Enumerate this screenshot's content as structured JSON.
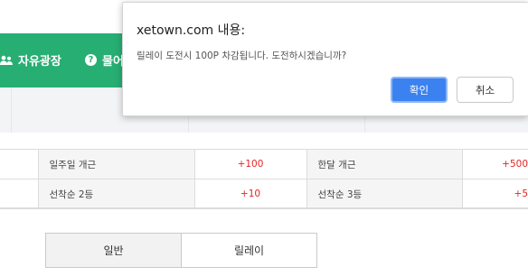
{
  "nav": {
    "items": [
      {
        "label": "자유광장",
        "icon": "users-icon"
      },
      {
        "label": "물어",
        "icon": "question-circle-icon"
      }
    ]
  },
  "rewards": {
    "rows": [
      [
        {
          "label": "일주일 개근",
          "value": "+100"
        },
        {
          "label": "한달 개근",
          "value": "+500"
        }
      ],
      [
        {
          "label": "선착순 2등",
          "value": "+10"
        },
        {
          "label": "선착순 3등",
          "value": "+5"
        }
      ]
    ],
    "value_color": "#e52424"
  },
  "mode_tabs": [
    {
      "label": "일반"
    },
    {
      "label": "릴레이"
    }
  ],
  "dialog": {
    "title": "xetown.com 내용:",
    "message": "릴레이 도전시 100P 차감됩니다. 도전하시겠습니까?",
    "ok_label": "확인",
    "cancel_label": "취소"
  },
  "colors": {
    "nav_bg": "#27ae73",
    "ok_button": "#3b82f0"
  }
}
